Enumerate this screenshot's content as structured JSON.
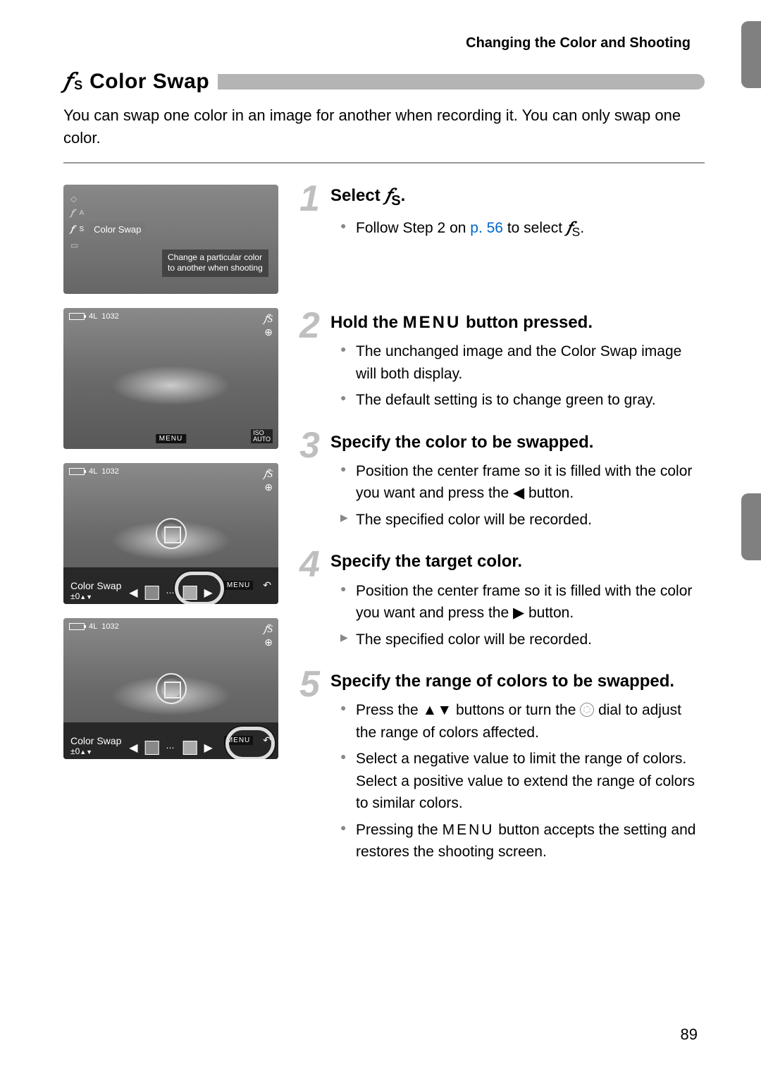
{
  "header": {
    "section_label": "Changing the Color and Shooting"
  },
  "title": {
    "icon_glyph": "𝑓",
    "icon_sub": "S",
    "text": "Color Swap"
  },
  "intro": "You can swap one color in an image for another when recording it. You can only swap one color.",
  "screens": {
    "s1": {
      "mode_label": "Color Swap",
      "desc_line1": "Change a particular color",
      "desc_line2": "to another when shooting"
    },
    "hud": {
      "shots": "1032",
      "quality": "4L",
      "mode_glyph": "𝑓S",
      "target": "⊕",
      "iso": "ISO\nAUTO",
      "menu": "MENU"
    },
    "bar": {
      "label": "Color Swap",
      "menu": "MENU",
      "pm": "±0",
      "updown": "▲▼"
    }
  },
  "steps": [
    {
      "num": "1",
      "title_a": "Select ",
      "title_b": "𝑓",
      "title_c": "S",
      "title_d": ".",
      "b1a": "Follow Step 2 on ",
      "b1link": "p. 56",
      "b1b": " to select ",
      "b1icon": "𝑓",
      "b1sub": "S",
      "b1c": "."
    },
    {
      "num": "2",
      "title_a": "Hold the ",
      "title_menu": "MENU",
      "title_b": " button pressed.",
      "b1": "The unchanged image and the Color Swap image will both display.",
      "b2": "The default setting is to change green to gray."
    },
    {
      "num": "3",
      "title": "Specify the color to be swapped.",
      "b1a": "Position the center frame so it is filled with the color you want and press the ",
      "b1arrow": "◀",
      "b1b": " button.",
      "b2": "The specified color will be recorded."
    },
    {
      "num": "4",
      "title": "Specify the target color.",
      "b1a": "Position the center frame so it is filled with the color you want and press the ",
      "b1arrow": "▶",
      "b1b": " button.",
      "b2": "The specified color will be recorded."
    },
    {
      "num": "5",
      "title": "Specify the range of colors to be swapped.",
      "b1a": "Press the ",
      "b1arrows": "▲▼",
      "b1b": " buttons or turn the ",
      "b1c": " dial to adjust the range of colors affected.",
      "b2": "Select a negative value to limit the range of colors. Select a positive value to extend the range of colors to similar colors.",
      "b3a": "Pressing the ",
      "b3menu": "MENU",
      "b3b": " button accepts the setting and restores the shooting screen."
    }
  ],
  "page_number": "89"
}
